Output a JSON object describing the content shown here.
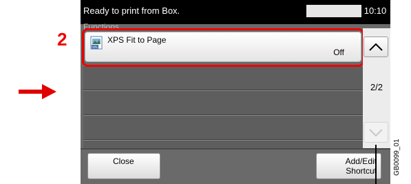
{
  "status": {
    "message": "Ready to print from Box.",
    "time": "10:10"
  },
  "section_label": "Functions",
  "callout": {
    "number": "2",
    "color": "#e00000"
  },
  "items": [
    {
      "label": "XPS Fit to Page",
      "value": "Off",
      "icon": "xps-document-icon"
    }
  ],
  "scroll": {
    "page_indicator": "2/2",
    "up_icon": "chevron-up-icon",
    "down_icon": "chevron-down-icon"
  },
  "footer": {
    "close_label": "Close",
    "add_edit_line1": "Add/Edit",
    "add_edit_line2": "Shortcut"
  },
  "figure_code": "GB0099_01",
  "colors": {
    "panel_bg": "#6a6a6a",
    "highlight": "#e00000",
    "arrow": "#e00000"
  }
}
